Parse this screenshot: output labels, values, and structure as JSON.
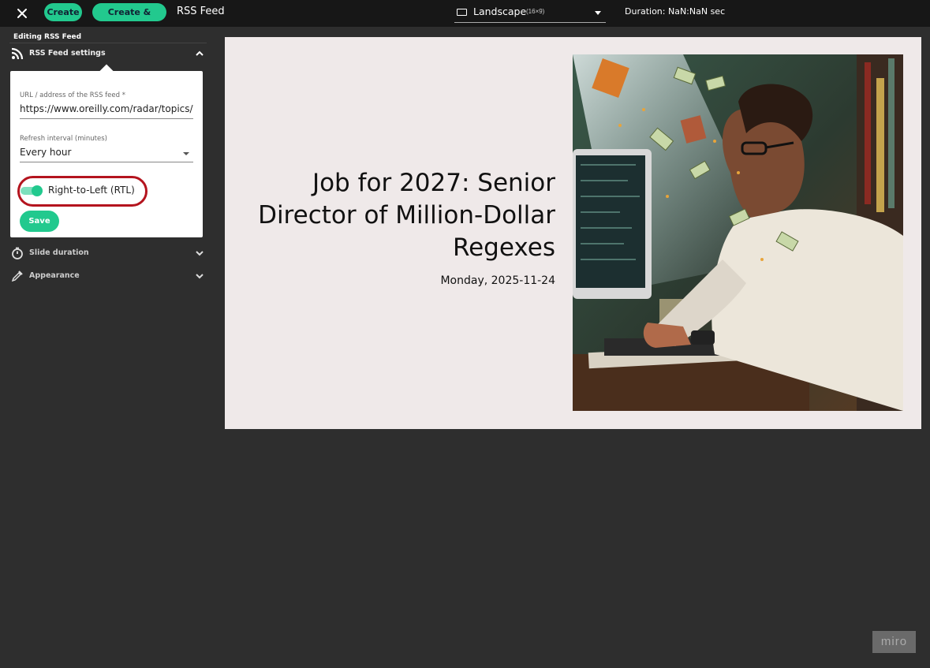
{
  "topbar": {
    "close_icon": "close-icon",
    "create_label": "Create",
    "publish_label": "Create & Publish",
    "app_title": "RSS Feed",
    "orientation_label": "Landscape",
    "orientation_ratio": "(16×9)",
    "duration_text": "Duration: NaN:NaN sec"
  },
  "sidebar": {
    "heading": "Editing RSS Feed",
    "sections": {
      "rss_settings": "RSS Feed settings",
      "slide_duration": "Slide duration",
      "appearance": "Appearance"
    },
    "form": {
      "url_label": "URL / address of the RSS feed *",
      "url_value": "https://www.oreilly.com/radar/topics/ai",
      "interval_label": "Refresh interval (minutes)",
      "interval_value": "Every hour",
      "rtl_label": "Right-to-Left (RTL)",
      "rtl_enabled": true,
      "save_label": "Save"
    }
  },
  "preview": {
    "headline": "Job for 2027: Senior Director of Million-Dollar Regexes",
    "date": "Monday, 2025-11-24"
  },
  "watermark": "miro",
  "colors": {
    "accent": "#22c98e",
    "highlight": "#b4141e",
    "topbar": "#171717",
    "canvas": "#2e2e2e",
    "slide_bg": "#efe9e9"
  }
}
